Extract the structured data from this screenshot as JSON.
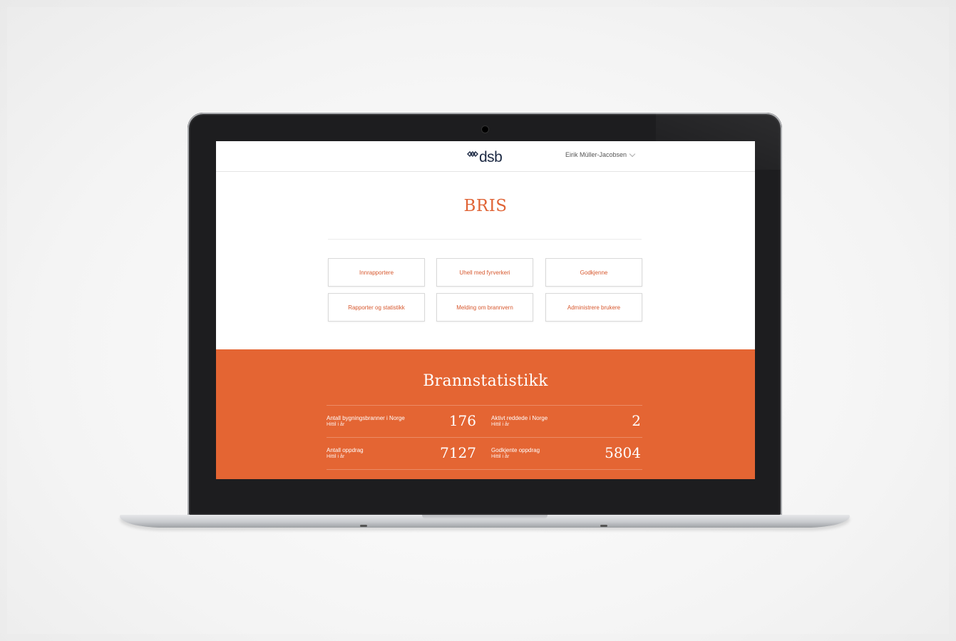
{
  "app": {
    "logo_text": "dsb",
    "user_name": "Eirik Müller-Jacobsen",
    "title": "BRIS"
  },
  "menu_tiles": [
    {
      "label": "Innrapportere"
    },
    {
      "label": "Uhell med fyrverkeri"
    },
    {
      "label": "Godkjenne"
    },
    {
      "label": "Rapporter og statistikk"
    },
    {
      "label": "Melding om brannvern"
    },
    {
      "label": "Administrere brukere"
    }
  ],
  "stats": {
    "title": "Brannstatistikk",
    "items": [
      {
        "label": "Antall bygningsbranner i Norge",
        "sub": "Hittil i år",
        "value": "176"
      },
      {
        "label": "Aktivt reddede i Norge",
        "sub": "Hittil i år",
        "value": "2"
      },
      {
        "label": "Antall oppdrag",
        "sub": "Hittil i år",
        "value": "7127"
      },
      {
        "label": "Godkjente oppdrag",
        "sub": "Hittil i år",
        "value": "5804"
      }
    ]
  },
  "colors": {
    "accent": "#e46533",
    "title_orange": "#e06436",
    "logo_navy": "#1d2a44"
  },
  "icons": {
    "logo_mark": "dsb-logo-icon",
    "user_dropdown": "chevron-down-icon",
    "webcam": "camera-icon"
  }
}
